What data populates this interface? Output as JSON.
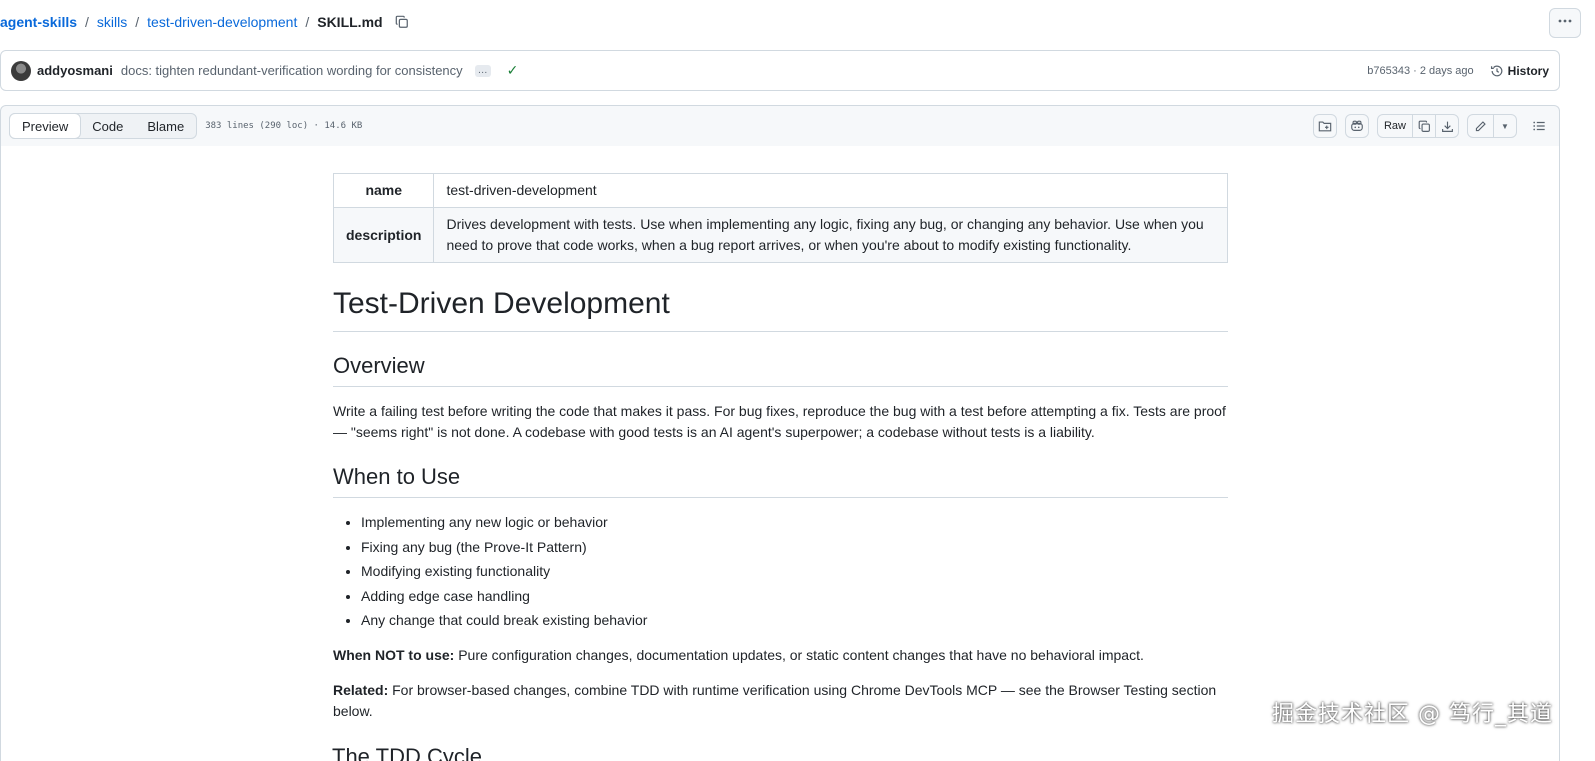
{
  "breadcrumb": {
    "repo": "agent-skills",
    "folder1": "skills",
    "folder2": "test-driven-development",
    "file": "SKILL.md"
  },
  "commit": {
    "author": "addyosmani",
    "message": "docs: tighten redundant-verification wording for consistency",
    "meta": "b765343 · 2 days ago",
    "history_label": "History"
  },
  "file_header": {
    "tabs": [
      "Preview",
      "Code",
      "Blame"
    ],
    "active_tab": "Preview",
    "info": "383 lines (290 loc) · 14.6 KB",
    "raw_label": "Raw"
  },
  "frontmatter": {
    "name_key": "name",
    "name_value": "test-driven-development",
    "description_key": "description",
    "description_value": "Drives development with tests. Use when implementing any logic, fixing any bug, or changing any behavior. Use when you need to prove that code works, when a bug report arrives, or when you're about to modify existing functionality."
  },
  "doc": {
    "title": "Test-Driven Development",
    "overview_heading": "Overview",
    "overview_text": "Write a failing test before writing the code that makes it pass. For bug fixes, reproduce the bug with a test before attempting a fix. Tests are proof — \"seems right\" is not done. A codebase with good tests is an AI agent's superpower; a codebase without tests is a liability.",
    "when_heading": "When to Use",
    "when_items": [
      "Implementing any new logic or behavior",
      "Fixing any bug (the Prove-It Pattern)",
      "Modifying existing functionality",
      "Adding edge case handling",
      "Any change that could break existing behavior"
    ],
    "not_label": "When NOT to use:",
    "not_text": " Pure configuration changes, documentation updates, or static content changes that have no behavioral impact.",
    "related_label": "Related:",
    "related_text": " For browser-based changes, combine TDD with runtime verification using Chrome DevTools MCP — see the Browser Testing section below.",
    "next_heading_partial": "The TDD Cycle"
  },
  "watermark": "掘金技术社区 @ 笃行_其道"
}
